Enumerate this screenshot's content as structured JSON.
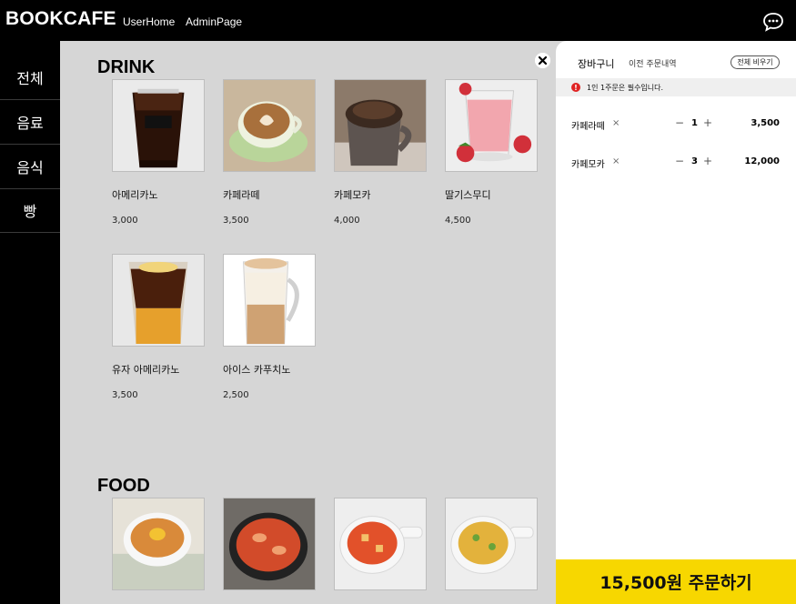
{
  "app": {
    "brand": "BOOKCAFE"
  },
  "nav": {
    "userhome": "UserHome",
    "adminpage": "AdminPage"
  },
  "sidebar": {
    "items": [
      {
        "label": "전체"
      },
      {
        "label": "음료"
      },
      {
        "label": "음식"
      },
      {
        "label": "빵"
      }
    ]
  },
  "sections": {
    "drink": {
      "title": "DRINK",
      "items": [
        {
          "name": "아메리카노",
          "price": "3,000"
        },
        {
          "name": "카페라떼",
          "price": "3,500"
        },
        {
          "name": "카페모카",
          "price": "4,000"
        },
        {
          "name": "딸기스무디",
          "price": "4,500"
        },
        {
          "name": "유자 아메리카노",
          "price": "3,500"
        },
        {
          "name": "아이스 카푸치노",
          "price": "2,500"
        }
      ]
    },
    "food": {
      "title": "FOOD"
    }
  },
  "cart": {
    "tab_active": "장바구니",
    "tab_history": "이전 주문내역",
    "clear_label": "전체 비우기",
    "notice_icon": "!",
    "notice": "1인 1주문은 필수입니다.",
    "remove_symbol": "×",
    "minus_symbol": "−",
    "plus_symbol": "+",
    "items": [
      {
        "name": "카페라떼",
        "qty": "1",
        "price": "3,500"
      },
      {
        "name": "카페모카",
        "qty": "3",
        "price": "12,000"
      }
    ],
    "order_label": "15,500원 주문하기"
  },
  "colors": {
    "accent": "#f7d700",
    "notice": "#e02424",
    "sidebar": "#000000",
    "content_bg": "#d6d6d6"
  }
}
